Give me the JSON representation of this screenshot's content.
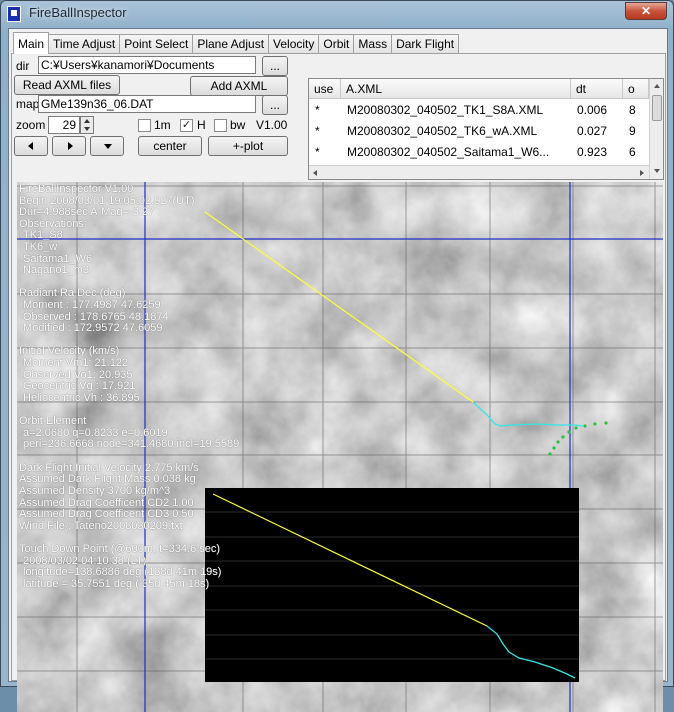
{
  "window": {
    "title": "FireBallInspector",
    "close": "✕"
  },
  "tabs": [
    "Main",
    "Time Adjust",
    "Point Select",
    "Plane Adjust",
    "Velocity",
    "Orbit",
    "Mass",
    "Dark Flight"
  ],
  "controls": {
    "dir_label": "dir",
    "dir_value": "C:¥Users¥kanamori¥Documents",
    "browse": "...",
    "read_axml": "Read AXML files",
    "add_axml": "Add AXML",
    "map_label": "map",
    "map_value": "GMe139n36_06.DAT",
    "zoom_label": "zoom",
    "zoom_value": "29",
    "opt_1m": "1m",
    "opt_h": "H",
    "opt_bw": "bw",
    "version": "V1.00",
    "center": "center",
    "plot": "+-plot",
    "checked_h": "✓"
  },
  "obs_table": {
    "headers": [
      "use",
      "A.XML",
      "dt",
      "o"
    ],
    "rows": [
      {
        "use": "*",
        "name": "M20080302_040502_TK1_S8A.XML",
        "dt": "0.006",
        "o": "8"
      },
      {
        "use": "*",
        "name": "M20080302_040502_TK6_wA.XML",
        "dt": "0.027",
        "o": "9"
      },
      {
        "use": "*",
        "name": "M20080302_040502_Saitama1_W6...",
        "dt": "0.923",
        "o": "6"
      }
    ]
  },
  "info_lines": [
    "FireBallInspector V1.00",
    "Begin 2008/03/01 19:05:02.927(UT)",
    "Dur=4.988sec A-Mag=-3.27",
    "Observations:",
    "  TK1_S8",
    "  TK6_w",
    "  Saitama1_W6",
    "  Nagano1_m3",
    "",
    "Radiant Ra Dec (deg)",
    "  Moment   : 177.4987 47.6259",
    "  Observed : 178.6765 48.1874",
    "  Modified : 172.9572 47.6059",
    "",
    "Initial Velocity (km/s)",
    "  Moment    Vm1: 21.122",
    "  Observed Vo1: 20.935",
    "  Geocentric Vg : 17.921",
    "  Heliocentric Vh : 36.895",
    "",
    "Orbit Element",
    "  a=2.0680 q=0.8233 e=0.6019",
    "  peri=236.6668 node=341.4680 incl=19.5589",
    "",
    "Dark Flight Initial Velocity 2.775 km/s",
    "Assumed Dark Flight Mass 0.038 kg",
    "Assumed Density 3700 kg/m^3",
    "Assumed Drag Coefficent CD2 1.00",
    "Assumed Drag Coefficent CD3 0.50",
    "Wind File : Tateno2008030209.txt",
    "",
    "Touch Down Point (@600m, t=334.6 sec)",
    "  2008/03/02 04:10:38 (LT)",
    "  longitude=138.6886 deg (138d 41m 19s)",
    "  latitude = 35.7551 deg ( 35d 45m 18s)"
  ],
  "colors": {
    "bright_path": "#ffff33",
    "dark_path": "#33e6e6",
    "grid": "#1c2fc8",
    "points": "#2fbf3f",
    "map_bg": "#8c8c8c",
    "inset_bg": "#000000"
  }
}
